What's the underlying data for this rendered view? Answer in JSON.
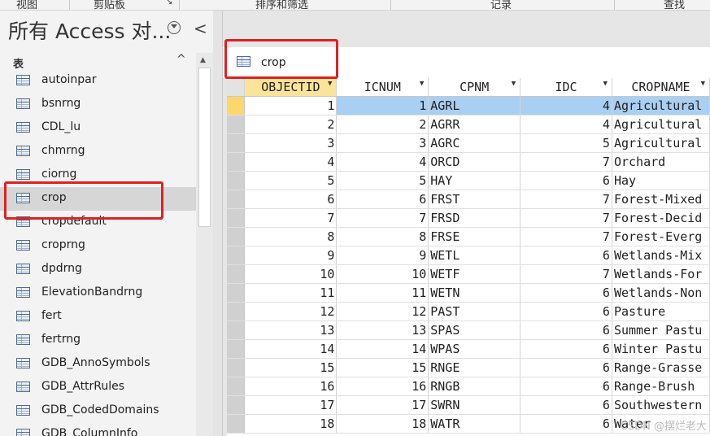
{
  "ribbon": {
    "groups": [
      "视图",
      "剪贴板",
      "排序和筛选",
      "记录",
      "查找"
    ]
  },
  "nav": {
    "title": "所有 Access 对...",
    "collapse_glyph": "<",
    "section_label": "表",
    "section_toggle": "^",
    "items": [
      {
        "label": "autoinpar"
      },
      {
        "label": "bsnrng"
      },
      {
        "label": "CDL_lu"
      },
      {
        "label": "chmrng"
      },
      {
        "label": "ciorng"
      },
      {
        "label": "crop",
        "selected": true
      },
      {
        "label": "cropdefault"
      },
      {
        "label": "croprng"
      },
      {
        "label": "dpdrng"
      },
      {
        "label": "ElevationBandrng"
      },
      {
        "label": "fert"
      },
      {
        "label": "fertrng"
      },
      {
        "label": "GDB_AnnoSymbols"
      },
      {
        "label": "GDB_AttrRules"
      },
      {
        "label": "GDB_CodedDomains"
      },
      {
        "label": "GDB_ColumnInfo"
      }
    ]
  },
  "doc_tab": {
    "label": "crop"
  },
  "table": {
    "columns": [
      "OBJECTID",
      "ICNUM",
      "CPNM",
      "IDC",
      "CROPNAME"
    ],
    "rows": [
      [
        "1",
        "1",
        "AGRL",
        "4",
        "Agricultural"
      ],
      [
        "2",
        "2",
        "AGRR",
        "4",
        "Agricultural"
      ],
      [
        "3",
        "3",
        "AGRC",
        "5",
        "Agricultural"
      ],
      [
        "4",
        "4",
        "ORCD",
        "7",
        "Orchard"
      ],
      [
        "5",
        "5",
        "HAY",
        "6",
        "Hay"
      ],
      [
        "6",
        "6",
        "FRST",
        "7",
        "Forest-Mixed"
      ],
      [
        "7",
        "7",
        "FRSD",
        "7",
        "Forest-Decid"
      ],
      [
        "8",
        "8",
        "FRSE",
        "7",
        "Forest-Everg"
      ],
      [
        "9",
        "9",
        "WETL",
        "6",
        "Wetlands-Mix"
      ],
      [
        "10",
        "10",
        "WETF",
        "7",
        "Wetlands-For"
      ],
      [
        "11",
        "11",
        "WETN",
        "6",
        "Wetlands-Non"
      ],
      [
        "12",
        "12",
        "PAST",
        "6",
        "Pasture"
      ],
      [
        "13",
        "13",
        "SPAS",
        "6",
        "Summer Pastu"
      ],
      [
        "14",
        "14",
        "WPAS",
        "6",
        "Winter Pastu"
      ],
      [
        "15",
        "15",
        "RNGE",
        "6",
        "Range-Grasse"
      ],
      [
        "16",
        "16",
        "RNGB",
        "6",
        "Range-Brush"
      ],
      [
        "17",
        "17",
        "SWRN",
        "6",
        "Southwestern"
      ],
      [
        "18",
        "18",
        "WATR",
        "6",
        "Water"
      ]
    ]
  },
  "watermark": "CSDN @摆烂老大",
  "colors": {
    "highlight_box": "#e02020",
    "selected_row": "#a9cff2",
    "record_selector": "#fcd76c"
  }
}
